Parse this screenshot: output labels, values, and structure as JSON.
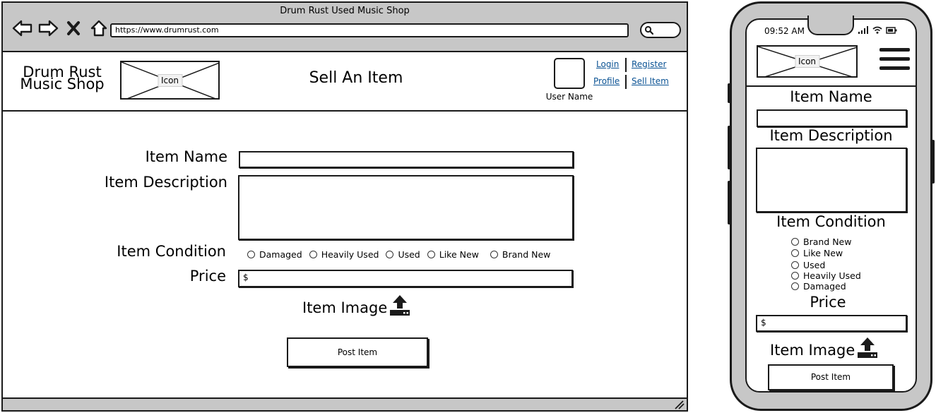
{
  "browser": {
    "window_title": "Drum Rust Used Music Shop",
    "url": "https://www.drumrust.com"
  },
  "header": {
    "shop_name_line1": "Drum Rust",
    "shop_name_line2": "Music Shop",
    "logo_label": "Icon",
    "page_title": "Sell An Item",
    "user_name": "User Name",
    "links": {
      "login": "Login",
      "register": "Register",
      "profile": "Profile",
      "sell_item": "Sell Item"
    }
  },
  "form": {
    "item_name_label": "Item Name",
    "item_description_label": "Item Description",
    "item_condition_label": "Item Condition",
    "condition_options": [
      "Damaged",
      "Heavily Used",
      "Used",
      "Like New",
      "Brand New"
    ],
    "price_label": "Price",
    "price_prefix": "$",
    "item_image_label": "Item Image",
    "submit_label": "Post Item"
  },
  "mobile": {
    "status_time": "09:52 AM",
    "logo_label": "Icon",
    "item_name_label": "Item Name",
    "item_description_label": "Item Description",
    "item_condition_label": "Item Condition",
    "condition_options": [
      "Brand New",
      "Like New",
      "Used",
      "Heavily Used",
      "Damaged"
    ],
    "price_label": "Price",
    "price_prefix": "$",
    "item_image_label": "Item Image",
    "submit_label": "Post Item"
  },
  "icons": [
    "back-arrow-icon",
    "forward-arrow-icon",
    "close-icon",
    "home-icon",
    "search-icon",
    "upload-icon",
    "hamburger-menu-icon",
    "signal-icon",
    "wifi-icon",
    "battery-icon"
  ],
  "colors": {
    "chrome_gray": "#c7c7c7",
    "link_blue": "#0b5394",
    "stroke": "#1a1a1a"
  }
}
